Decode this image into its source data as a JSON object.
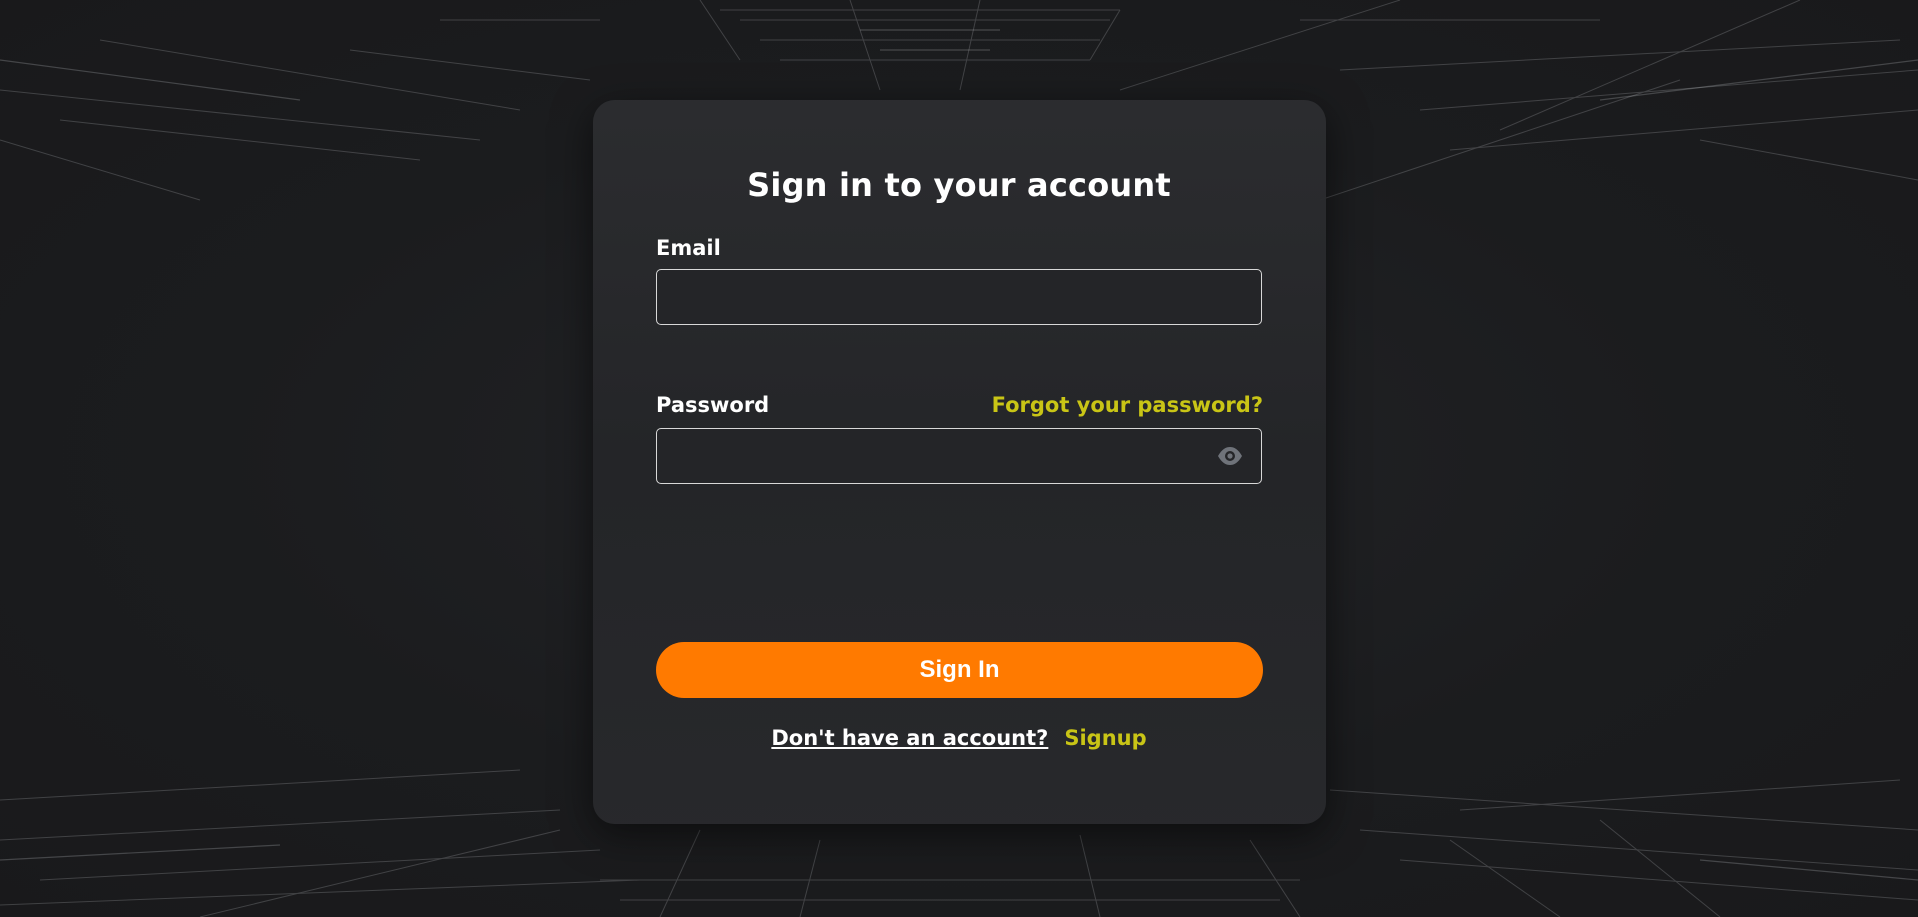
{
  "form": {
    "title": "Sign in to your account",
    "email_label": "Email",
    "email_value": "",
    "password_label": "Password",
    "password_value": "",
    "forgot_link": "Forgot your password?",
    "show_password_icon": "eye-icon",
    "submit_label": "Sign In",
    "no_account_text": "Don't have an account?",
    "signup_link": "Signup"
  },
  "colors": {
    "accent_button": "#ff7a00",
    "link": "#c9c516",
    "background": "#1c1d1f",
    "card": "#2a2b2e"
  }
}
